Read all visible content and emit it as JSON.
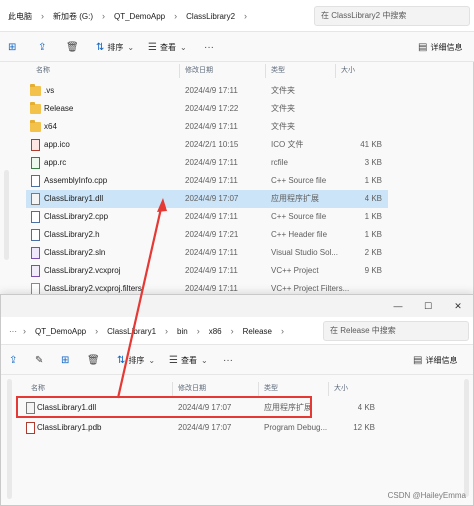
{
  "back_window": {
    "breadcrumb": [
      "此电脑",
      "新加卷 (G:)",
      "QT_DemoApp",
      "ClassLibrary2"
    ],
    "search_placeholder": "在 ClassLibrary2 中搜索",
    "toolbar": {
      "sort_label": "排序",
      "view_label": "查看",
      "details_label": "详细信息"
    },
    "columns": {
      "name": "名称",
      "modified": "修改日期",
      "type": "类型",
      "size": "大小"
    },
    "files": [
      {
        "name": ".vs",
        "date": "2024/4/9 17:11",
        "type": "文件夹",
        "size": "",
        "icon": "folder-icon"
      },
      {
        "name": "Release",
        "date": "2024/4/9 17:22",
        "type": "文件夹",
        "size": "",
        "icon": "folder-icon"
      },
      {
        "name": "x64",
        "date": "2024/4/9 17:11",
        "type": "文件夹",
        "size": "",
        "icon": "folder-icon"
      },
      {
        "name": "app.ico",
        "date": "2024/2/1 10:15",
        "type": "ICO 文件",
        "size": "41 KB",
        "icon": "ico-file-icon"
      },
      {
        "name": "app.rc",
        "date": "2024/4/9 17:11",
        "type": "rcfile",
        "size": "3 KB",
        "icon": "rc-file-icon"
      },
      {
        "name": "AssemblyInfo.cpp",
        "date": "2024/4/9 17:11",
        "type": "C++ Source file",
        "size": "1 KB",
        "icon": "cpp-file-icon"
      },
      {
        "name": "ClassLibrary1.dll",
        "date": "2024/4/9 17:07",
        "type": "应用程序扩展",
        "size": "4 KB",
        "icon": "dll-file-icon"
      },
      {
        "name": "ClassLibrary2.cpp",
        "date": "2024/4/9 17:11",
        "type": "C++ Source file",
        "size": "1 KB",
        "icon": "cpp-file-icon"
      },
      {
        "name": "ClassLibrary2.h",
        "date": "2024/4/9 17:21",
        "type": "C++ Header file",
        "size": "1 KB",
        "icon": "header-file-icon"
      },
      {
        "name": "ClassLibrary2.sln",
        "date": "2024/4/9 17:11",
        "type": "Visual Studio Sol...",
        "size": "2 KB",
        "icon": "sln-file-icon"
      },
      {
        "name": "ClassLibrary2.vcxproj",
        "date": "2024/4/9 17:11",
        "type": "VC++ Project",
        "size": "9 KB",
        "icon": "vcxproj-file-icon"
      },
      {
        "name": "ClassLibrary2.vcxproj.filters",
        "date": "2024/4/9 17:11",
        "type": "VC++ Project Filters...",
        "size": "",
        "icon": "filters-file-icon"
      }
    ]
  },
  "front_window": {
    "more_glyph": "···",
    "breadcrumb": [
      "QT_DemoApp",
      "ClassLibrary1",
      "bin",
      "x86",
      "Release"
    ],
    "search_placeholder": "在 Release 中搜索",
    "toolbar": {
      "sort_label": "排序",
      "view_label": "查看",
      "details_label": "详细信息"
    },
    "columns": {
      "name": "名称",
      "modified": "修改日期",
      "type": "类型",
      "size": "大小"
    },
    "files": [
      {
        "name": "ClassLibrary1.dll",
        "date": "2024/4/9 17:07",
        "type": "应用程序扩展",
        "size": "4 KB",
        "icon": "dll-file-icon"
      },
      {
        "name": "ClassLibrary1.pdb",
        "date": "2024/4/9 17:07",
        "type": "Program Debug...",
        "size": "12 KB",
        "icon": "pdb-file-icon"
      }
    ]
  },
  "watermark": "CSDN @HaileyEmma",
  "colors": {
    "highlight": "#e53935",
    "selection": "#cce4f7",
    "accent": "#0b63c5"
  }
}
